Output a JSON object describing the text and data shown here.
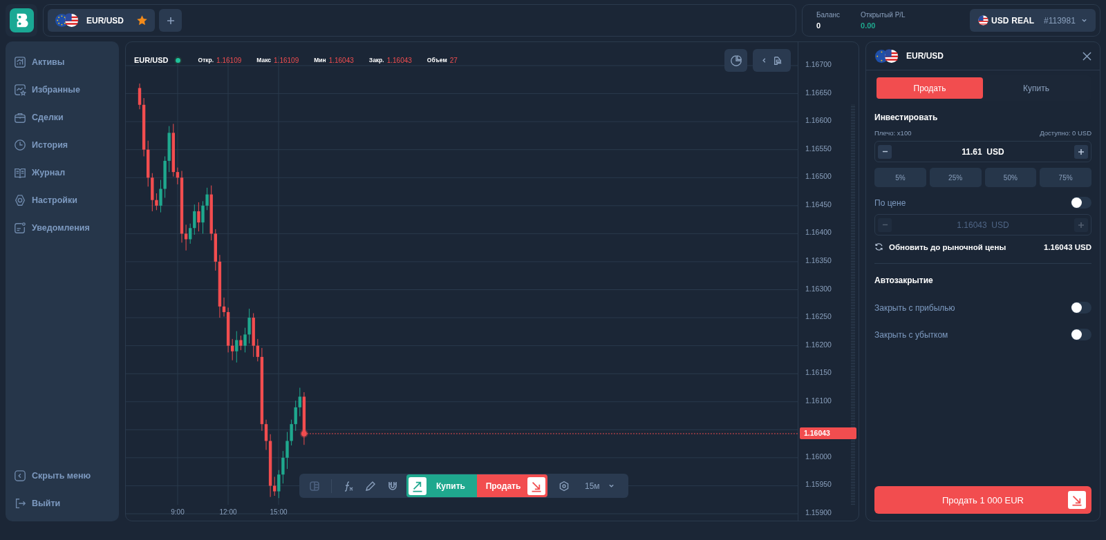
{
  "asset_tabs": [
    {
      "label": "EUR/USD",
      "favorite": true
    }
  ],
  "account": {
    "balance_label": "Баланс",
    "balance": "0",
    "pl_label": "Открытый P/L",
    "pl": "0.00",
    "currency": "USD",
    "mode": "REAL",
    "id": "#113981"
  },
  "sidebar": {
    "items": [
      {
        "label": "Активы"
      },
      {
        "label": "Избранные"
      },
      {
        "label": "Сделки"
      },
      {
        "label": "История"
      },
      {
        "label": "Журнал"
      },
      {
        "label": "Настройки"
      },
      {
        "label": "Уведомления"
      }
    ],
    "bottom": [
      {
        "label": "Скрыть меню"
      },
      {
        "label": "Выйти"
      }
    ]
  },
  "chart": {
    "symbol": "EUR/USD",
    "live": true,
    "stats": [
      {
        "label": "Откр.",
        "value": "1.16109"
      },
      {
        "label": "Макс",
        "value": "1.16109"
      },
      {
        "label": "Мин",
        "value": "1.16043"
      },
      {
        "label": "Закр.",
        "value": "1.16043"
      },
      {
        "label": "Объем",
        "value": "27"
      }
    ],
    "price_axis": [
      "1.16700",
      "1.16650",
      "1.16600",
      "1.16550",
      "1.16500",
      "1.16450",
      "1.16400",
      "1.16350",
      "1.16300",
      "1.16250",
      "1.16200",
      "1.16150",
      "1.16100",
      "1.16000",
      "1.15950",
      "1.15900"
    ],
    "time_axis": [
      "9:00",
      "12:00",
      "15:00"
    ],
    "current_price": "1.16043"
  },
  "toolbar": {
    "buy": "Купить",
    "sell": "Продать",
    "timeframe": "15м"
  },
  "order": {
    "symbol": "EUR/USD",
    "sides": [
      {
        "label": "Продать",
        "selected": true
      },
      {
        "label": "Купить",
        "selected": false
      }
    ],
    "invest_title": "Инвестировать",
    "leverage": "Плечо: x100",
    "available": "Доступно: 0 USD",
    "amount": "11.61  USD",
    "presets": [
      "5%",
      "25%",
      "50%",
      "75%"
    ],
    "by_price": {
      "label": "По цене",
      "on": false
    },
    "price_field": {
      "value": "1.16043  USD",
      "disabled": true
    },
    "refresh_label": "Обновить до рыночной цены",
    "market_price": "1.16043 USD",
    "autoclose_title": "Автозакрытие",
    "autoclose": [
      {
        "label": "Закрыть с прибылью",
        "on": false
      },
      {
        "label": "Закрыть с убытком",
        "on": false
      }
    ],
    "submit": "Продать 1 000 EUR"
  }
}
